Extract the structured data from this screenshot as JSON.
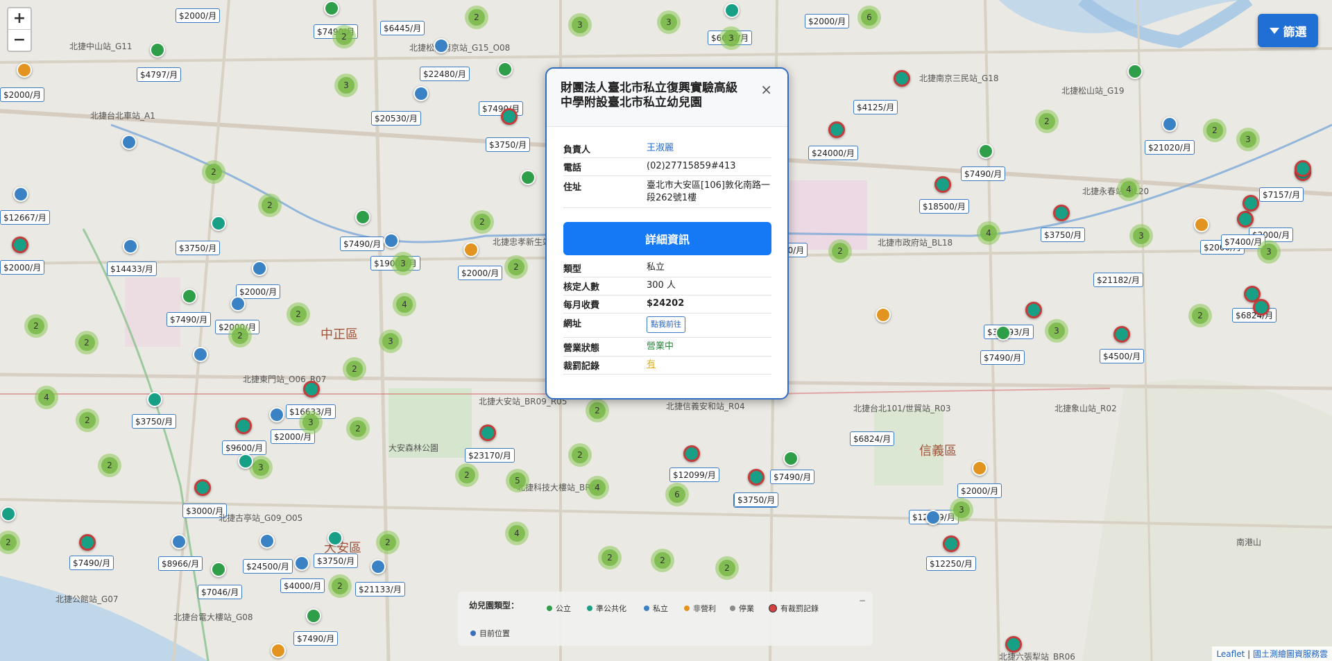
{
  "map": {
    "zoom_in": "+",
    "zoom_out": "−",
    "filter_label": "篩選",
    "districts": [
      "中正區",
      "大安區",
      "信義區"
    ],
    "places": [
      "北捷中山站_G11",
      "北捷台北車站_A1",
      "北捷忠孝新生站",
      "北捷大安站_BR09_R05",
      "北捷信義安和站_R04",
      "北捷台北101/世貿站_R03",
      "北捷松山站_G19",
      "北捷南京三民站_G18",
      "北捷松江南京站_G15_O08",
      "北捷科技大樓站_BR08",
      "北捷六張犁站_BR06",
      "北捷台電大樓站_G08",
      "北捷古亭站_G09_O05",
      "北捷東門站_O06_R07",
      "北捷市政府站_BL18",
      "北捷永春站_BL20",
      "北捷象山站_R02",
      "大安森林公園",
      "北捷公館站_G07",
      "南港山"
    ]
  },
  "prices": [
    "$2000/月",
    "$7490/月",
    "$6445/月",
    "$6000/月",
    "$2000/月",
    "$4797/月",
    "$22480/月",
    "$2000/月",
    "$20530/月",
    "$7490/月",
    "$3750/月",
    "$4125/月",
    "$24000/月",
    "$7490/月",
    "$21020/月",
    "$2000/月",
    "$12667/月",
    "$3750/月",
    "$7490/月",
    "$19000/月",
    "$2000/月",
    "$18500/月",
    "$3750/月",
    "$2000/月",
    "$7400/月",
    "$21182/月",
    "$7157/月",
    "$14433/月",
    "$2000/月",
    "$7490/月",
    "$2000/月",
    "$2000/月",
    "$35893/月",
    "$6824/月",
    "$4500/月",
    "$7490/月",
    "$2000/月",
    "$3750/月",
    "$16633/月",
    "$2000/月",
    "$9600/月",
    "$23170/月",
    "$6824/月",
    "$3750/月",
    "$12099/月",
    "$3750/月",
    "$7490/月",
    "$2000/月",
    "$3000/月",
    "$12999/月",
    "$12250/月",
    "$7490/月",
    "$8966/月",
    "$24500/月",
    "$3750/月",
    "$4000/月",
    "$21133/月",
    "$7046/月",
    "$7490/月"
  ],
  "popup": {
    "title": "財團法人臺北市私立復興實驗高級中學附設臺北市私立幼兒園",
    "close": "×",
    "rows_top": [
      {
        "k": "負責人",
        "v": "王淑麗"
      },
      {
        "k": "電話",
        "v": "(02)27715859#413"
      },
      {
        "k": "住址",
        "v": "臺北市大安區[106]敦化南路一段262號1樓"
      }
    ],
    "detail_button": "詳細資訊",
    "type_k": "類型",
    "type_v": "私立",
    "capacity_k": "核定人數",
    "capacity_v": "300 人",
    "fee_k": "每月收費",
    "fee_v": "$24202",
    "website_k": "網址",
    "website_v": "點我前往",
    "status_k": "營業狀態",
    "status_v": "營業中",
    "penalty_k": "裁罰記錄",
    "penalty_v": "有"
  },
  "legend": {
    "title": "幼兒園類型：",
    "items": [
      {
        "label": "公立",
        "color": "#2e9e48"
      },
      {
        "label": "準公共化",
        "color": "#17a085"
      },
      {
        "label": "私立",
        "color": "#3b82c4"
      },
      {
        "label": "非營利",
        "color": "#e39420"
      },
      {
        "label": "停業",
        "color": "#8a8a8a"
      },
      {
        "label": "有裁罰記錄",
        "color": "#d44141"
      }
    ],
    "current_location": "目前位置",
    "current_color": "#3b6fb8",
    "collapse": "−"
  },
  "attribution": {
    "leaflet": "Leaflet",
    "sep": " | ",
    "source": "國土測繪圖資服務雲"
  }
}
